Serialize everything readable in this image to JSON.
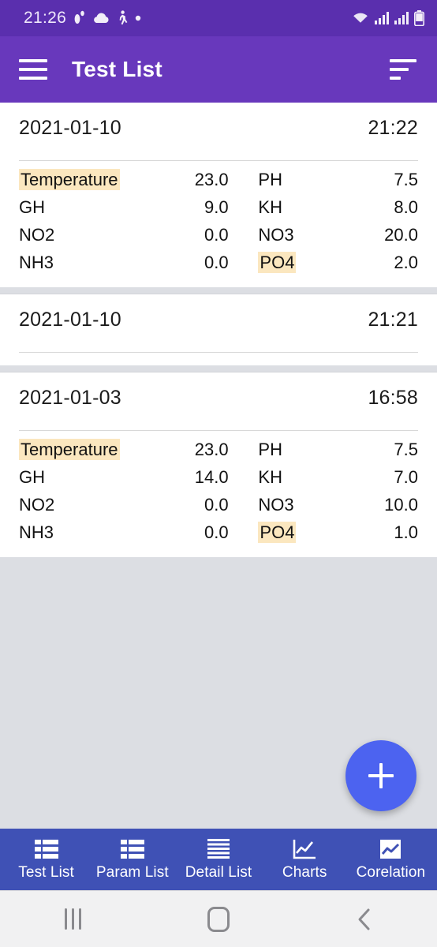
{
  "status_bar": {
    "time": "21:26",
    "left_icons": [
      "footsteps-icon",
      "cloud-icon",
      "walking-person-icon",
      "dot-icon"
    ],
    "right_icons": [
      "wifi-icon",
      "signal-bars-icon",
      "signal-bars-2-icon",
      "battery-icon"
    ],
    "background": "#5a2fae"
  },
  "app_bar": {
    "title": "Test List",
    "menu_icon": "hamburger-menu-icon",
    "sort_icon": "sort-icon",
    "background": "#6838bc"
  },
  "highlight_color": "#fbe7bf",
  "accent_color": "#4c63f0",
  "nav_background": "#3f51b5",
  "tests": [
    {
      "date": "2021-01-10",
      "time": "21:22",
      "rows": [
        {
          "label1": "Temperature",
          "value1": "23.0",
          "label2": "PH",
          "value2": "7.5",
          "hl1": true,
          "hl2": false
        },
        {
          "label1": "GH",
          "value1": "9.0",
          "label2": "KH",
          "value2": "8.0",
          "hl1": false,
          "hl2": false
        },
        {
          "label1": "NO2",
          "value1": "0.0",
          "label2": "NO3",
          "value2": "20.0",
          "hl1": false,
          "hl2": false
        },
        {
          "label1": "NH3",
          "value1": "0.0",
          "label2": "PO4",
          "value2": "2.0",
          "hl1": false,
          "hl2": true
        }
      ]
    },
    {
      "date": "2021-01-10",
      "time": "21:21",
      "rows": []
    },
    {
      "date": "2021-01-03",
      "time": "16:58",
      "rows": [
        {
          "label1": "Temperature",
          "value1": "23.0",
          "label2": "PH",
          "value2": "7.5",
          "hl1": true,
          "hl2": false
        },
        {
          "label1": "GH",
          "value1": "14.0",
          "label2": "KH",
          "value2": "7.0",
          "hl1": false,
          "hl2": false
        },
        {
          "label1": "NO2",
          "value1": "0.0",
          "label2": "NO3",
          "value2": "10.0",
          "hl1": false,
          "hl2": false
        },
        {
          "label1": "NH3",
          "value1": "0.0",
          "label2": "PO4",
          "value2": "1.0",
          "hl1": false,
          "hl2": true
        }
      ]
    }
  ],
  "fab": {
    "icon": "plus-icon",
    "label": "+"
  },
  "bottom_nav": {
    "items": [
      {
        "label": "Test List",
        "icon": "list-table-icon",
        "active": true
      },
      {
        "label": "Param List",
        "icon": "list-table-icon",
        "active": false
      },
      {
        "label": "Detail List",
        "icon": "lines-list-icon",
        "active": false
      },
      {
        "label": "Charts",
        "icon": "line-chart-icon",
        "active": false
      },
      {
        "label": "Corelation",
        "icon": "filled-chart-icon",
        "active": false
      }
    ]
  },
  "system_nav": {
    "recents": "recents-icon",
    "home": "home-icon",
    "back": "back-icon"
  }
}
